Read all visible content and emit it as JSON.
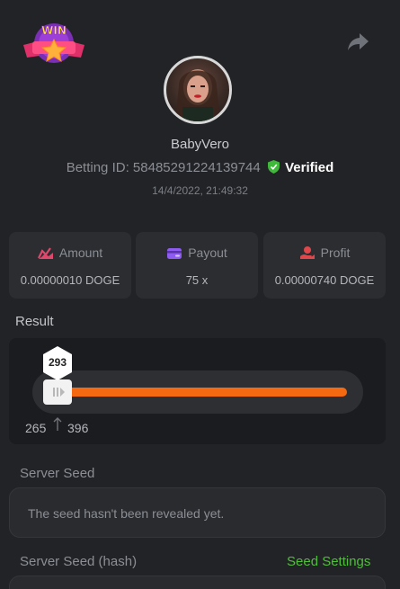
{
  "header": {
    "badge_text": "WIN",
    "share_icon": "share-icon"
  },
  "profile": {
    "username": "BabyVero",
    "betting_id_label": "Betting ID:",
    "betting_id": "58485291224139744",
    "verified_label": "Verified",
    "timestamp": "14/4/2022, 21:49:32"
  },
  "stats": [
    {
      "label": "Amount",
      "value": "0.00000010 DOGE",
      "icon": "amount-icon",
      "color": "#e0476b"
    },
    {
      "label": "Payout",
      "value": "75 x",
      "icon": "payout-icon",
      "color": "#8e5cf0"
    },
    {
      "label": "Profit",
      "value": "0.00000740 DOGE",
      "icon": "profit-icon",
      "color": "#e0474a"
    }
  ],
  "result": {
    "label": "Result",
    "value": "293",
    "range_min": "265",
    "range_max": "396",
    "bar_color": "#f56a10"
  },
  "server_seed": {
    "label": "Server Seed",
    "value": "The seed hasn't been revealed yet."
  },
  "server_seed_hash": {
    "label": "Server Seed (hash)",
    "settings_link": "Seed Settings"
  },
  "colors": {
    "background": "#222326",
    "card": "#2c2d31",
    "verified_green": "#3fb83b",
    "link_green": "#4fbf3a"
  }
}
